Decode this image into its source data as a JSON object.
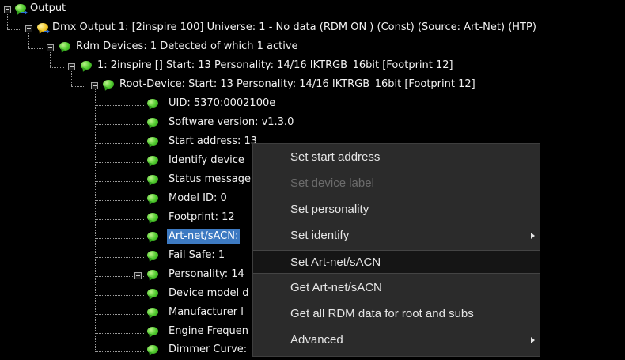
{
  "tree": {
    "root": "Output",
    "dmx_output": "Dmx Output 1: [2inspire 100] Universe: 1  - No data (RDM ON  ) (Const) (Source: Art-Net) (HTP)",
    "rdm_devices": "Rdm Devices: 1 Detected of which 1 active",
    "device": "1: 2inspire [] Start: 13 Personality: 14/16 IKTRGB_16bit [Footprint 12]",
    "root_device": "Root-Device: Start: 13 Personality: 14/16 IKTRGB_16bit [Footprint 12]",
    "leaves": [
      "UID: 5370:0002100e",
      "Software version: v1.3.0",
      "Start address: 13",
      "Identify device",
      "Status message",
      "Model ID: 0",
      "Footprint: 12",
      "Art-net/sACN:",
      "Fail Safe: 1",
      "Personality: 14",
      "Device model d",
      "Manufacturer l",
      "Engine Frequen",
      "Dimmer Curve:"
    ]
  },
  "context_menu": {
    "items": [
      {
        "label": "Set start address"
      },
      {
        "label": "Set device label"
      },
      {
        "label": "Set personality"
      },
      {
        "label": "Set identify"
      },
      {
        "label": "Set Art-net/sACN"
      },
      {
        "label": "Get Art-net/sACN"
      },
      {
        "label": "Get all RDM data for root and subs"
      },
      {
        "label": "Advanced"
      }
    ]
  },
  "colors": {
    "background": "#000000",
    "selection": "#3d7ac2",
    "menu_bg": "#2b2b2b",
    "menu_highlight": "#151515",
    "menu_disabled": "#6c6c6c",
    "bubble_green": "#4fca2d",
    "bubble_yellow": "#f1c82a"
  }
}
